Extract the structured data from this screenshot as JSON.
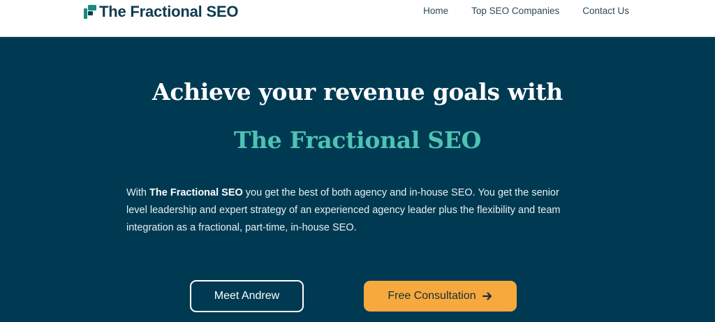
{
  "header": {
    "brand": "The Fractional SEO",
    "brand_icon": "fractional-seo-logo-icon",
    "nav": [
      {
        "label": "Home"
      },
      {
        "label": "Top SEO Companies"
      },
      {
        "label": "Contact Us"
      }
    ]
  },
  "hero": {
    "title": "Achieve your revenue goals with",
    "highlight": "The Fractional SEO",
    "body_lead": "With ",
    "body_bold": "The Fractional SEO",
    "body_rest": " you get the best of both agency and in-house SEO. You get the senior level leadership and expert strategy of an experienced agency leader plus the flexibility and team integration as a fractional, part-time, in-house SEO."
  },
  "buttons": {
    "meet": "Meet Andrew",
    "consult": "Free Consultation",
    "consult_icon": "arrow-right-icon"
  },
  "colors": {
    "hero_background": "#003A52",
    "accent_teal": "#4EC3B3",
    "cta_orange": "#F8A93D",
    "brand_navy": "#0D3B4F"
  }
}
